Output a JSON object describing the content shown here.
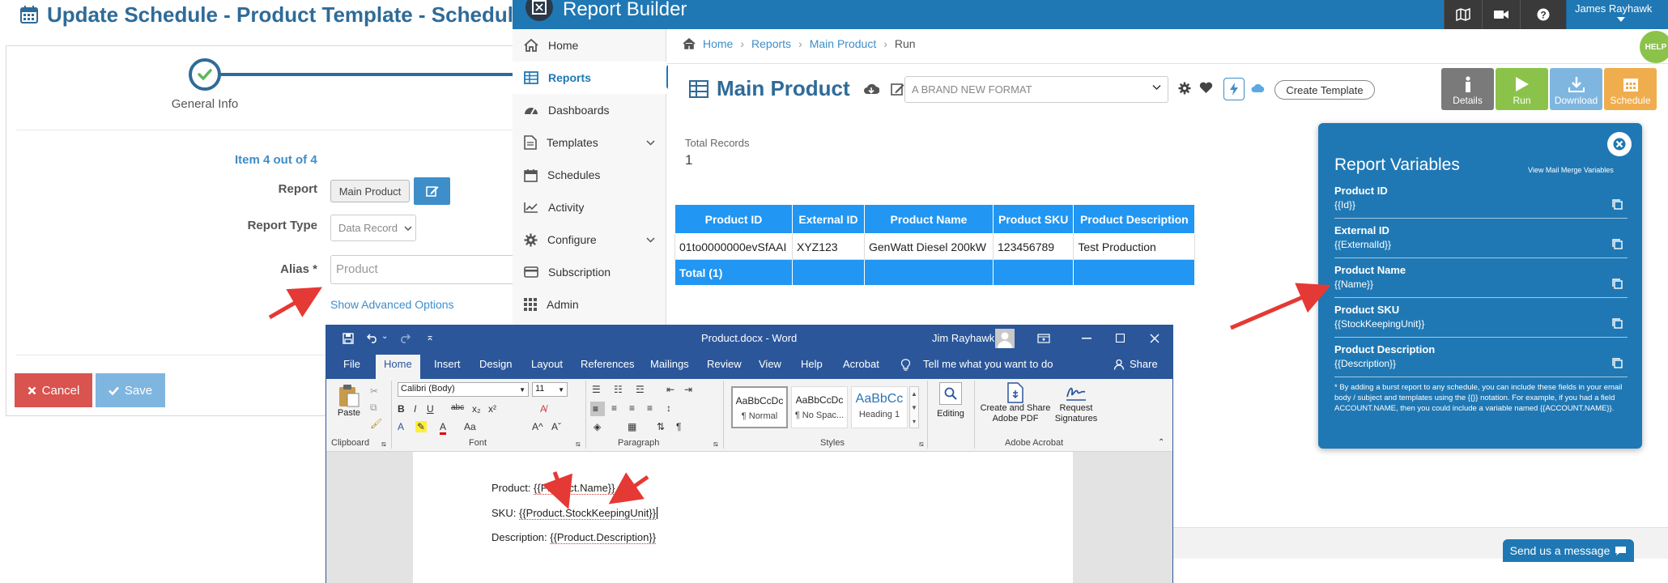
{
  "schedule": {
    "title": "Update Schedule - Product Template - Schedule",
    "step_label": "General Info",
    "item_counter": "Item 4 out of 4",
    "report_label": "Report",
    "report_value": "Main Product",
    "report_type_label": "Report Type",
    "report_type_value": "Data Record",
    "alias_label": "Alias *",
    "alias_placeholder": "Product",
    "advanced_link": "Show Advanced Options",
    "cancel_label": "Cancel",
    "save_label": "Save"
  },
  "report_builder": {
    "app_title": "Report Builder",
    "user_name": "James Rayhawk",
    "help_badge": "HELP",
    "nav": [
      {
        "label": "Home"
      },
      {
        "label": "Reports"
      },
      {
        "label": "Dashboards"
      },
      {
        "label": "Templates"
      },
      {
        "label": "Schedules"
      },
      {
        "label": "Activity"
      },
      {
        "label": "Configure"
      },
      {
        "label": "Subscription"
      },
      {
        "label": "Admin"
      }
    ],
    "breadcrumb": [
      "Home",
      "Reports",
      "Main Product",
      "Run"
    ],
    "page_title": "Main Product",
    "format_value": "A BRAND NEW FORMAT",
    "create_template": "Create Template",
    "actions": [
      "Details",
      "Run",
      "Download",
      "Schedule"
    ],
    "total_records_label": "Total Records",
    "total_records_value": "1",
    "table": {
      "headers": [
        "Product ID",
        "External ID",
        "Product Name",
        "Product SKU",
        "Product Description"
      ],
      "row": [
        "01to0000000evSfAAI",
        "XYZ123",
        "GenWatt Diesel 200kW",
        "123456789",
        "Test Production"
      ],
      "total": "Total (1)"
    },
    "send_message": "Send us a message"
  },
  "variables_panel": {
    "title": "Report Variables",
    "mail_merge_link": "View Mail Merge Variables",
    "items": [
      {
        "name": "Product ID",
        "value": "{{Id}}"
      },
      {
        "name": "External ID",
        "value": "{{ExternalId}}"
      },
      {
        "name": "Product Name",
        "value": "{{Name}}"
      },
      {
        "name": "Product SKU",
        "value": "{{StockKeepingUnit}}"
      },
      {
        "name": "Product Description",
        "value": "{{Description}}"
      }
    ],
    "note": "* By adding a burst report to any schedule, you can include these fields in your email body / subject and templates using the {{}} notation. For example, if you had a field ACCOUNT.NAME, then you could include a variable named {{ACCOUNT.NAME}}."
  },
  "word": {
    "doc_title": "Product.docx - Word",
    "user": "Jim Rayhawk",
    "tabs": [
      "File",
      "Home",
      "Insert",
      "Design",
      "Layout",
      "References",
      "Mailings",
      "Review",
      "View",
      "Help",
      "Acrobat"
    ],
    "tell_me": "Tell me what you want to do",
    "share": "Share",
    "font_name": "Calibri (Body)",
    "font_size": "11",
    "paste": "Paste",
    "groups": [
      "Clipboard",
      "Font",
      "Paragraph",
      "Styles",
      "Adobe Acrobat"
    ],
    "styles": [
      {
        "preview": "AaBbCcDc",
        "name": "¶ Normal"
      },
      {
        "preview": "AaBbCcDc",
        "name": "¶ No Spac..."
      },
      {
        "preview": "AaBbCc",
        "name": "Heading 1"
      }
    ],
    "editing": "Editing",
    "create_share": "Create and Share Adobe PDF",
    "request_sig": "Request Signatures",
    "doc_lines": [
      {
        "prefix": "Product: ",
        "field": "{{Product.Name}}"
      },
      {
        "prefix": "SKU: ",
        "field": "{{Product.StockKeepingUnit}}"
      },
      {
        "prefix": "Description: ",
        "field": "{{Product.Description}}"
      }
    ]
  },
  "colors": {
    "brand_blue": "#1f78b4",
    "table_blue": "#2196f3",
    "word_blue": "#2b579a",
    "cancel_red": "#d9534f",
    "run_green": "#8bc34a",
    "download_blue": "#7fb6e0",
    "schedule_orange": "#f0ad4e",
    "details_gray": "#7a7a7a",
    "annotation_red": "#e53935"
  }
}
